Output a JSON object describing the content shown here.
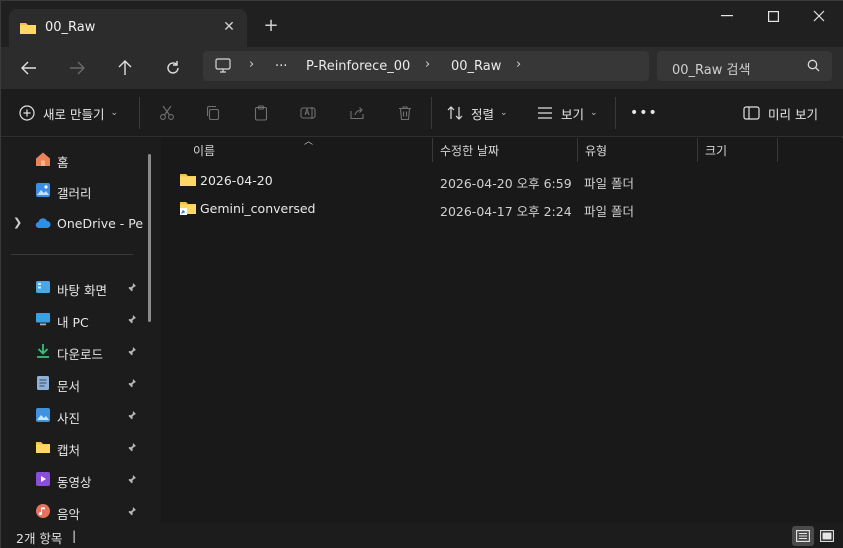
{
  "tab": {
    "title": "00_Raw",
    "close": "✕",
    "new_tab": "+"
  },
  "window_controls": {
    "minimize": "—",
    "maximize": "☐",
    "close": "✕"
  },
  "breadcrumb": {
    "overflow": "···",
    "segments": [
      "P-Reinforece_00",
      "00_Raw"
    ],
    "separator": "›"
  },
  "search": {
    "placeholder": "00_Raw 검색"
  },
  "toolbar": {
    "new_label": "새로 만들기",
    "sort_label": "정렬",
    "view_label": "보기",
    "more_label": "•••",
    "preview_label": "미리 보기"
  },
  "sidebar": {
    "items": [
      {
        "label": "홈",
        "icon": "home-icon"
      },
      {
        "label": "갤러리",
        "icon": "gallery-icon"
      },
      {
        "label": "OneDrive - Pers",
        "icon": "onedrive-icon"
      },
      {
        "label": "바탕 화면",
        "icon": "desktop-icon"
      },
      {
        "label": "내 PC",
        "icon": "this-pc-icon"
      },
      {
        "label": "다운로드",
        "icon": "download-icon"
      },
      {
        "label": "문서",
        "icon": "documents-icon"
      },
      {
        "label": "사진",
        "icon": "pictures-icon"
      },
      {
        "label": "캡처",
        "icon": "capture-folder-icon"
      },
      {
        "label": "동영상",
        "icon": "videos-icon"
      },
      {
        "label": "음악",
        "icon": "music-icon"
      }
    ]
  },
  "columns": {
    "name": "이름",
    "modified": "수정한 날짜",
    "type": "유형",
    "size": "크기"
  },
  "files": [
    {
      "name": "2026-04-20",
      "modified": "2026-04-20 오후 6:59",
      "type": "파일 폴더",
      "icon": "folder-icon"
    },
    {
      "name": "Gemini_conversed",
      "modified": "2026-04-17 오후 2:24",
      "type": "파일 폴더",
      "icon": "shared-folder-icon"
    }
  ],
  "status": {
    "count": "2개 항목",
    "cursor": "|"
  },
  "colors": {
    "background": "#191919",
    "toolbar": "#2c2c2c",
    "folder": "#f5c04a",
    "accent": "#4ea1ff"
  }
}
